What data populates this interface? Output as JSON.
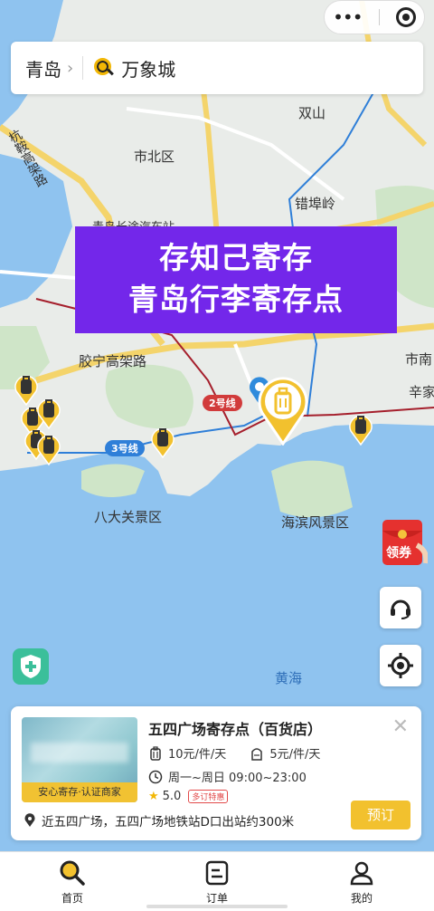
{
  "search": {
    "city": "青岛",
    "city_chevron": "›",
    "query": "万象城"
  },
  "capsule": {
    "more_icon": "more-dots-icon",
    "close_icon": "target-circle-icon"
  },
  "banner": {
    "line1": "存知己寄存",
    "line2": "青岛行李寄存点"
  },
  "map_labels": {
    "shuangshan": "双山",
    "shibei": "市北区",
    "cuobuling": "错埠岭",
    "bus_station": "青岛长途汽车站",
    "jiaoning": "胶宁高架路",
    "hangzhou": "杭鞍高架路",
    "shinan": "市南",
    "xinjia": "辛家",
    "badaguan": "八大关景区",
    "haibin": "海滨风景区",
    "huanghai": "黄海"
  },
  "line_tags": {
    "line2": "2号线",
    "line3": "3号线"
  },
  "colors": {
    "accent": "#f2c12e",
    "banner": "#7327ea",
    "water": "#8fc3ef",
    "land": "#e9ece9",
    "green": "#cfe5c8",
    "metro_blue": "#2f7fd8",
    "metro_red": "#d13b3b"
  },
  "coupon": {
    "label": "领券"
  },
  "store": {
    "title": "五四广场寄存点（百货店）",
    "thumb_tag": "安心寄存·认证商家",
    "price_large": "10元/件/天",
    "price_small": "5元/件/天",
    "hours": "周一~周日 09:00~23:00",
    "rating": "5.0",
    "promo": "多订特惠",
    "address": "近五四广场，五四广场地铁站D口出站约300米",
    "reserve_label": "预订",
    "close": "✕"
  },
  "tabs": [
    {
      "label": "首页",
      "icon": "search-icon"
    },
    {
      "label": "订单",
      "icon": "order-icon"
    },
    {
      "label": "我的",
      "icon": "user-icon"
    }
  ]
}
